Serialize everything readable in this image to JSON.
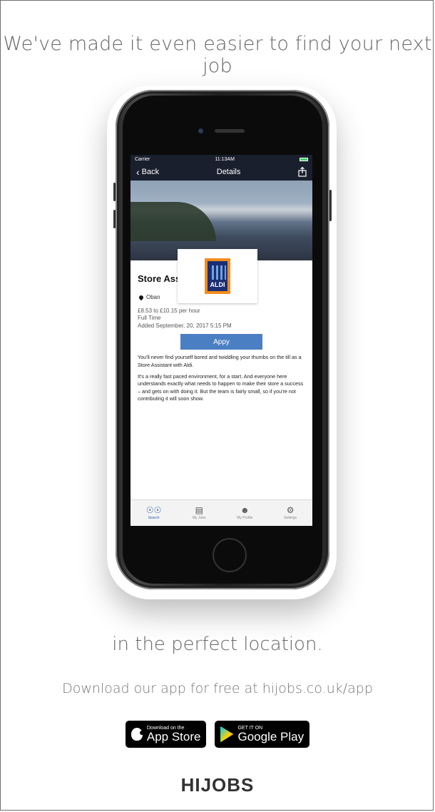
{
  "headline": "We've made it even easier to find your next job",
  "phone": {
    "status": {
      "carrier": "Carrier",
      "time": "11:13AM"
    },
    "nav": {
      "back_label": "Back",
      "title": "Details"
    },
    "job": {
      "logo_text": "ALDI",
      "title": "Store Assistant (Oban)",
      "location": "Oban",
      "salary": "£8.53 to £10.15 per hour",
      "type": "Full Time",
      "added": "Added September, 20, 2017 5:15 PM",
      "apply_label": "Appy",
      "description_1": "You'll never find yourself bored and twiddling your thumbs on the till as a Store Assistant with Aldi.",
      "description_2": "It's a really fast paced environment, for a start. And everyone here understands exactly what needs to happen to make their store a success – and gets on with doing it. But the team is fairly small, so if you're not contributing it will soon show."
    },
    "tabs": [
      {
        "label": "Search",
        "icon": "binoculars-icon"
      },
      {
        "label": "My Jobs",
        "icon": "briefcase-icon"
      },
      {
        "label": "My Profile",
        "icon": "person-icon"
      },
      {
        "label": "Settings",
        "icon": "gear-icon"
      }
    ]
  },
  "subtitle": "in the perfect location.",
  "download_text": "Download our app for free at hijobs.co.uk/app",
  "badges": {
    "appstore": {
      "small": "Download on the",
      "big": "App Store"
    },
    "googleplay": {
      "small": "GET IT ON",
      "big": "Google Play"
    }
  },
  "brand": "HIJOBS",
  "colors": {
    "apply_button": "#4a80c3",
    "nav_bar": "#1a1f2e",
    "active_tab": "#2a5fb0"
  }
}
